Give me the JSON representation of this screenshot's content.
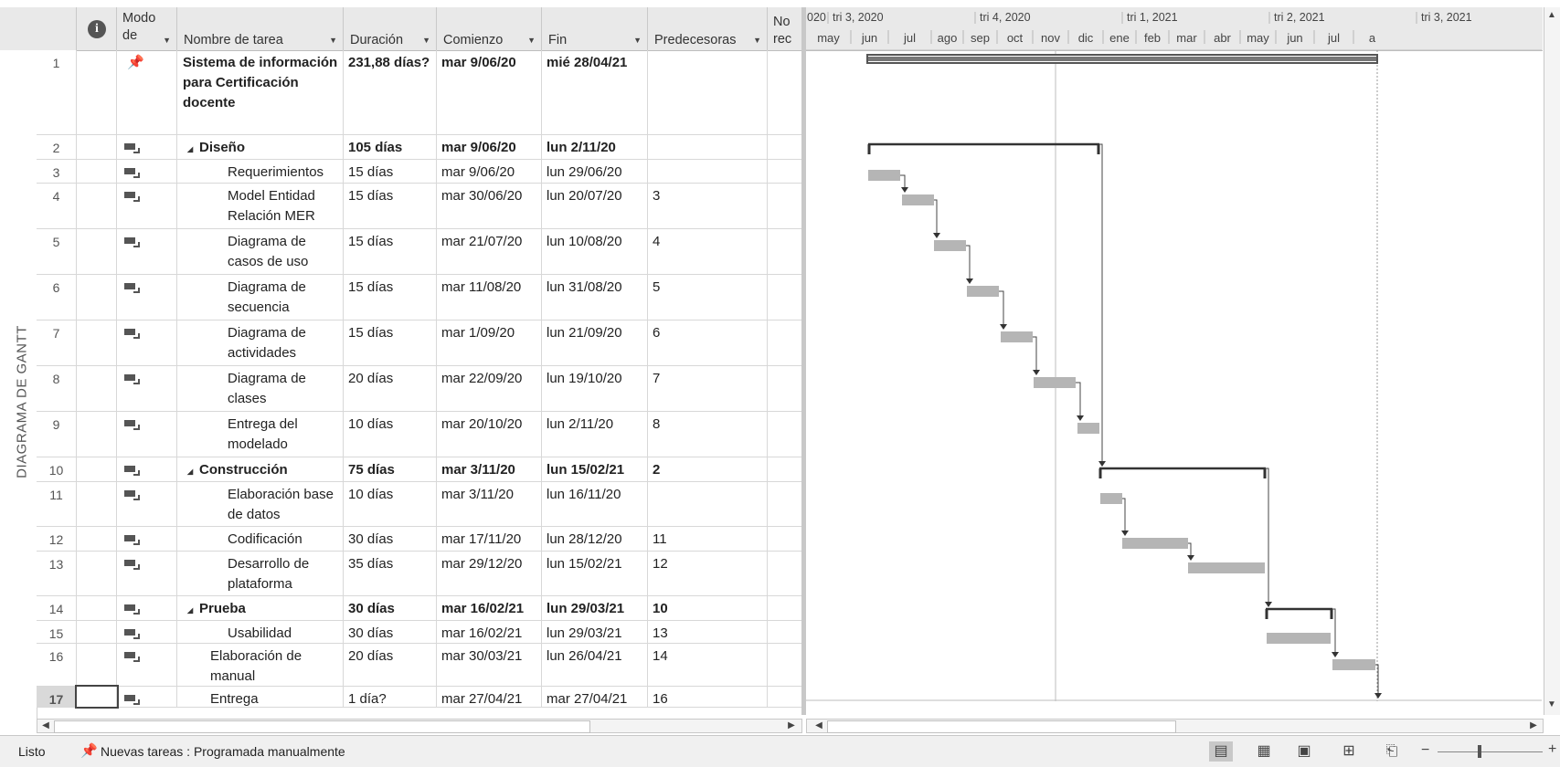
{
  "side_label": "DIAGRAMA DE GANTT",
  "columns": {
    "info": "ⓘ",
    "mode": "Modo de",
    "name": "Nombre de tarea",
    "duration": "Duración",
    "start": "Comienzo",
    "end": "Fin",
    "pred": "Predecesoras",
    "res": "No rec"
  },
  "tasks": [
    {
      "id": "1",
      "name": "Sistema de información para Certificación docente",
      "duration": "231,88 días?",
      "start": "mar 9/06/20",
      "end": "mié 28/04/21",
      "pred": "",
      "level": 0,
      "summary": true,
      "mode": "pin"
    },
    {
      "id": "2",
      "name": "Diseño",
      "duration": "105 días",
      "start": "mar 9/06/20",
      "end": "lun 2/11/20",
      "pred": "",
      "level": 1,
      "summary": true,
      "mode": "auto"
    },
    {
      "id": "3",
      "name": "Requerimientos",
      "duration": "15 días",
      "start": "mar 9/06/20",
      "end": "lun 29/06/20",
      "pred": "",
      "level": 2,
      "summary": false,
      "mode": "auto"
    },
    {
      "id": "4",
      "name": "Model Entidad Relación MER",
      "duration": "15 días",
      "start": "mar 30/06/20",
      "end": "lun 20/07/20",
      "pred": "3",
      "level": 2,
      "summary": false,
      "mode": "auto"
    },
    {
      "id": "5",
      "name": "Diagrama de casos de uso",
      "duration": "15 días",
      "start": "mar 21/07/20",
      "end": "lun 10/08/20",
      "pred": "4",
      "level": 2,
      "summary": false,
      "mode": "auto"
    },
    {
      "id": "6",
      "name": "Diagrama de secuencia",
      "duration": "15 días",
      "start": "mar 11/08/20",
      "end": "lun 31/08/20",
      "pred": "5",
      "level": 2,
      "summary": false,
      "mode": "auto"
    },
    {
      "id": "7",
      "name": "Diagrama de actividades",
      "duration": "15 días",
      "start": "mar 1/09/20",
      "end": "lun 21/09/20",
      "pred": "6",
      "level": 2,
      "summary": false,
      "mode": "auto"
    },
    {
      "id": "8",
      "name": "Diagrama de clases",
      "duration": "20 días",
      "start": "mar 22/09/20",
      "end": "lun 19/10/20",
      "pred": "7",
      "level": 2,
      "summary": false,
      "mode": "auto"
    },
    {
      "id": "9",
      "name": "Entrega del modelado",
      "duration": "10 días",
      "start": "mar 20/10/20",
      "end": "lun 2/11/20",
      "pred": "8",
      "level": 2,
      "summary": false,
      "mode": "auto"
    },
    {
      "id": "10",
      "name": "Construcción",
      "duration": "75 días",
      "start": "mar 3/11/20",
      "end": "lun 15/02/21",
      "pred": "2",
      "level": 1,
      "summary": true,
      "mode": "auto"
    },
    {
      "id": "11",
      "name": "Elaboración base de datos",
      "duration": "10 días",
      "start": "mar 3/11/20",
      "end": "lun 16/11/20",
      "pred": "",
      "level": 2,
      "summary": false,
      "mode": "auto"
    },
    {
      "id": "12",
      "name": "Codificación",
      "duration": "30 días",
      "start": "mar 17/11/20",
      "end": "lun 28/12/20",
      "pred": "11",
      "level": 2,
      "summary": false,
      "mode": "auto"
    },
    {
      "id": "13",
      "name": "Desarrollo de plataforma",
      "duration": "35 días",
      "start": "mar 29/12/20",
      "end": "lun 15/02/21",
      "pred": "12",
      "level": 2,
      "summary": false,
      "mode": "auto"
    },
    {
      "id": "14",
      "name": "Prueba",
      "duration": "30 días",
      "start": "mar 16/02/21",
      "end": "lun 29/03/21",
      "pred": "10",
      "level": 1,
      "summary": true,
      "mode": "auto"
    },
    {
      "id": "15",
      "name": "Usabilidad",
      "duration": "30 días",
      "start": "mar 16/02/21",
      "end": "lun 29/03/21",
      "pred": "13",
      "level": 2,
      "summary": false,
      "mode": "auto"
    },
    {
      "id": "16",
      "name": "Elaboración de manual",
      "duration": "20 días",
      "start": "mar 30/03/21",
      "end": "lun 26/04/21",
      "pred": "14",
      "level": 1,
      "summary": false,
      "mode": "auto"
    },
    {
      "id": "17",
      "name": "Entrega",
      "duration": "1 día?",
      "start": "mar 27/04/21",
      "end": "mar 27/04/21",
      "pred": "16",
      "level": 1,
      "summary": false,
      "mode": "auto"
    }
  ],
  "timescale": {
    "quarters": [
      "020",
      "tri 3, 2020",
      "tri 4, 2020",
      "tri 1, 2021",
      "tri 2, 2021",
      "tri 3, 2021"
    ],
    "months": [
      "may",
      "jun",
      "jul",
      "ago",
      "sep",
      "oct",
      "nov",
      "dic",
      "ene",
      "feb",
      "mar",
      "abr",
      "may",
      "jun",
      "jul",
      "a"
    ]
  },
  "status": {
    "ready": "Listo",
    "new_tasks": "Nuevas tareas : Programada manualmente"
  }
}
